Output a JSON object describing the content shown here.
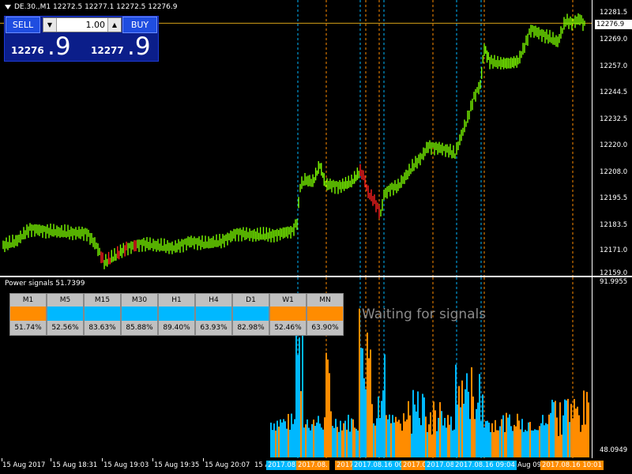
{
  "symbol": {
    "title": "DE.30.,M1  12272.5  12277.1  12272.5  12276.9"
  },
  "trade_panel": {
    "sell_label": "SELL",
    "buy_label": "BUY",
    "lot_value": "1.00",
    "down_symbol": "▼",
    "up_symbol": "▲",
    "sell_quote_small": "12276",
    "sell_quote_big": ".9",
    "buy_quote_small": "12277",
    "buy_quote_big": ".9",
    "colors": {
      "panel": "#0b1e8a",
      "button": "#1f4de0"
    }
  },
  "price_axis": {
    "ticks": [
      "12281.5",
      "12269.0",
      "12257.0",
      "12244.5",
      "12232.5",
      "12220.0",
      "12208.0",
      "12195.5",
      "12183.5",
      "12171.0",
      "12159.0"
    ],
    "current_price": "12276.9",
    "current_price_value": 12276.9
  },
  "indicator": {
    "title": "Power signals 51.7399",
    "waiting_text": "Waiting for signals",
    "axis_top": "91.9955",
    "axis_bottom": "48.0949",
    "timeframes": [
      {
        "name": "M1",
        "pct": "51.74%",
        "color": "#ff8c00"
      },
      {
        "name": "M5",
        "pct": "52.56%",
        "color": "#00b8ff"
      },
      {
        "name": "M15",
        "pct": "83.63%",
        "color": "#00b8ff"
      },
      {
        "name": "M30",
        "pct": "85.88%",
        "color": "#00b8ff"
      },
      {
        "name": "H1",
        "pct": "89.40%",
        "color": "#00b8ff"
      },
      {
        "name": "H4",
        "pct": "63.93%",
        "color": "#00b8ff"
      },
      {
        "name": "D1",
        "pct": "82.98%",
        "color": "#00b8ff"
      },
      {
        "name": "W1",
        "pct": "52.46%",
        "color": "#ff8c00"
      },
      {
        "name": "MN",
        "pct": "63.90%",
        "color": "#ff8c00"
      }
    ]
  },
  "time_axis": {
    "labels": [
      "15 Aug 2017",
      "15 Aug 18:31",
      "15 Aug 19:03",
      "15 Aug 19:35",
      "15 Aug 20:07",
      "15 Aug 20:39"
    ],
    "tags": [
      {
        "text": "2017.08",
        "color": "#00b8ff"
      },
      {
        "text": "2017.08.",
        "color": "#ff8c00"
      },
      {
        "text": "2017",
        "color": "#ff8c00"
      },
      {
        "text": "2017.08.16 00:0",
        "color": "#00b8ff"
      },
      {
        "text": "2017.0",
        "color": "#ff8c00"
      },
      {
        "text": "2017.08.",
        "color": "#00b8ff"
      },
      {
        "text": "2017.08.16 09:04",
        "color": "#00b8ff"
      },
      {
        "text": "Aug 09",
        "color": "#000000"
      },
      {
        "text": "2017.08.16 10:01",
        "color": "#ff8c00"
      }
    ]
  },
  "colors": {
    "bull": "#7cfc00",
    "bear": "#ff2020",
    "current_price_line": "#d4a017",
    "signal_buy": "#00b8ff",
    "signal_sell": "#ff8c00"
  }
}
